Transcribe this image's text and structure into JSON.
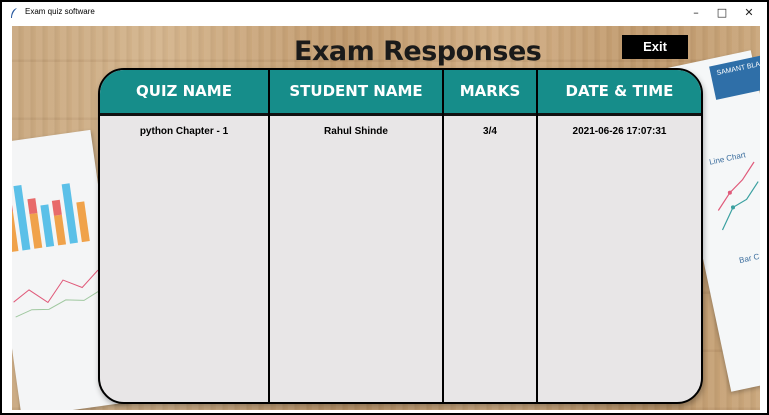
{
  "window": {
    "title": "Exam quiz software",
    "controls": {
      "minimize": "–",
      "maximize": "□",
      "close": "✕"
    }
  },
  "page": {
    "title": "Exam Responses",
    "exit_label": "Exit"
  },
  "background": {
    "left_paper_legend": "",
    "right_card_text": "SAMANT\nBLACK",
    "right_line_chart_label": "Line Chart",
    "right_bar_label": "Bar C"
  },
  "table": {
    "columns": [
      "QUIZ NAME",
      "STUDENT NAME",
      "MARKS",
      "DATE & TIME"
    ],
    "rows": [
      {
        "quiz_name": "python Chapter - 1",
        "student_name": "Rahul Shinde",
        "marks": "3/4",
        "date_time": "2021-06-26 17:07:31"
      }
    ]
  },
  "colors": {
    "header_teal": "#168d8a",
    "table_bg": "#e8e6e7",
    "exit_bg": "#000000"
  }
}
